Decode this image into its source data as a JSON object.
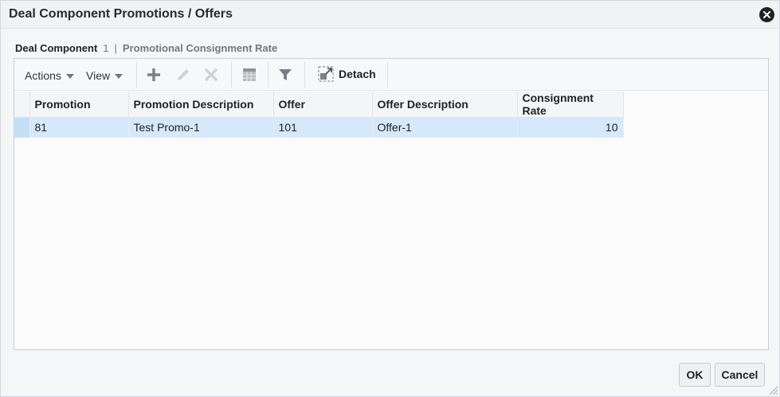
{
  "dialog": {
    "title": "Deal Component Promotions / Offers"
  },
  "subheader": {
    "label": "Deal Component",
    "number": "1",
    "separator": "|",
    "text": "Promotional Consignment Rate"
  },
  "toolbar": {
    "actions_label": "Actions",
    "view_label": "View",
    "detach_label": "Detach",
    "icons": [
      "plus-icon",
      "pencil-icon",
      "delete-x-icon",
      "freeze-icon",
      "filter-icon",
      "detach-icon"
    ]
  },
  "table": {
    "columns": [
      "Promotion",
      "Promotion Description",
      "Offer",
      "Offer Description",
      "Consignment Rate"
    ],
    "rows": [
      [
        "81",
        "Test Promo-1",
        "101",
        "Offer-1",
        "10"
      ]
    ]
  },
  "footer": {
    "ok_label": "OK",
    "cancel_label": "Cancel"
  },
  "colors": {
    "selected_row": "#d6e9fb",
    "header_bg": "#f1f2f4"
  }
}
